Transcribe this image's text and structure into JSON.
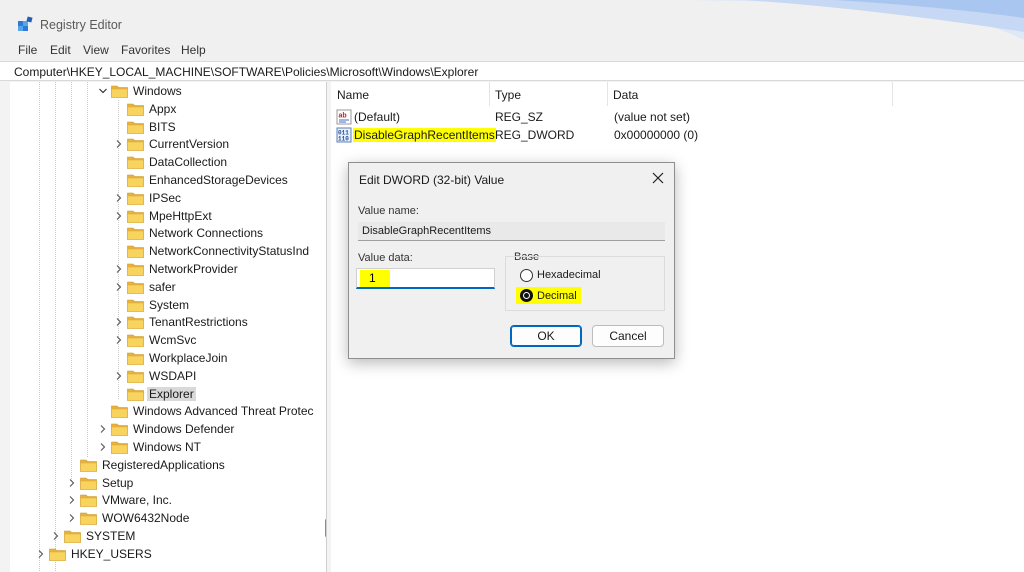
{
  "window": {
    "title": "Registry Editor"
  },
  "menu": [
    "File",
    "Edit",
    "View",
    "Favorites",
    "Help"
  ],
  "address": "Computer\\HKEY_LOCAL_MACHINE\\SOFTWARE\\Policies\\Microsoft\\Windows\\Explorer",
  "tree": [
    {
      "label": "Windows",
      "expanded": true
    },
    {
      "label": "Appx"
    },
    {
      "label": "BITS"
    },
    {
      "label": "CurrentVersion"
    },
    {
      "label": "DataCollection"
    },
    {
      "label": "EnhancedStorageDevices"
    },
    {
      "label": "IPSec"
    },
    {
      "label": "MpeHttpExt"
    },
    {
      "label": "Network Connections"
    },
    {
      "label": "NetworkConnectivityStatusInd"
    },
    {
      "label": "NetworkProvider"
    },
    {
      "label": "safer"
    },
    {
      "label": "System"
    },
    {
      "label": "TenantRestrictions"
    },
    {
      "label": "WcmSvc"
    },
    {
      "label": "WorkplaceJoin"
    },
    {
      "label": "WSDAPI"
    },
    {
      "label": "Explorer",
      "selected": true
    },
    {
      "label": "Windows Advanced Threat Protec"
    },
    {
      "label": "Windows Defender"
    },
    {
      "label": "Windows NT"
    },
    {
      "label": "RegisteredApplications"
    },
    {
      "label": "Setup"
    },
    {
      "label": "VMware, Inc."
    },
    {
      "label": "WOW6432Node"
    },
    {
      "label": "SYSTEM"
    },
    {
      "label": "HKEY_USERS"
    }
  ],
  "list": {
    "headers": {
      "name": "Name",
      "type": "Type",
      "data": "Data"
    },
    "rows": [
      {
        "name": "(Default)",
        "type": "REG_SZ",
        "data": "(value not set)",
        "icon": "string-value-icon"
      },
      {
        "name": "DisableGraphRecentItems",
        "type": "REG_DWORD",
        "data": "0x00000000 (0)",
        "icon": "binary-value-icon",
        "highlight": true
      }
    ]
  },
  "dialog": {
    "title": "Edit DWORD (32-bit) Value",
    "value_name_label": "Value name:",
    "value_name": "DisableGraphRecentItems",
    "value_data_label": "Value data:",
    "value_data": "1",
    "base_label": "Base",
    "hex_label": "Hexadecimal",
    "dec_label": "Decimal",
    "selected_base": "Decimal",
    "ok_label": "OK",
    "cancel_label": "Cancel"
  },
  "colors": {
    "highlight": "#ffff00",
    "accent": "#0067c0",
    "folder": "#f7c948"
  }
}
